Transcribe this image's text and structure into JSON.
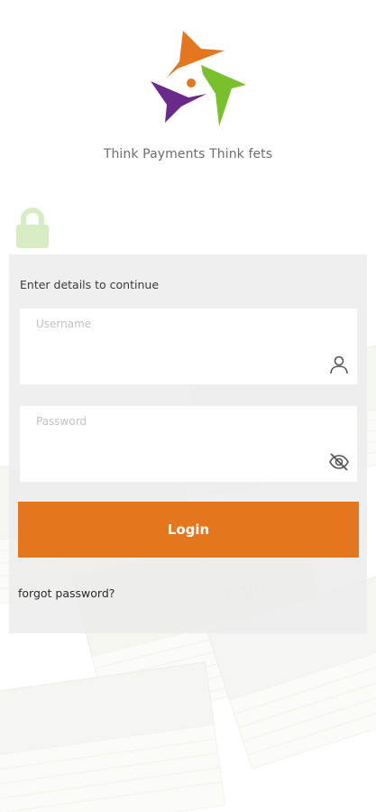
{
  "brand": {
    "tagline": "Think Payments Think fets",
    "colors": {
      "orange": "#e4761e",
      "green": "#78c02c",
      "purple": "#6a2a8c",
      "lock_green": "#d8ecc4"
    }
  },
  "login": {
    "heading": "Enter details to continue",
    "username_label": "Username",
    "password_label": "Password",
    "username_icon": "user-icon",
    "password_icon": "eye-off-icon",
    "login_label": "Login",
    "forgot_label": "forgot password?"
  },
  "background": {
    "note_value": "500"
  }
}
